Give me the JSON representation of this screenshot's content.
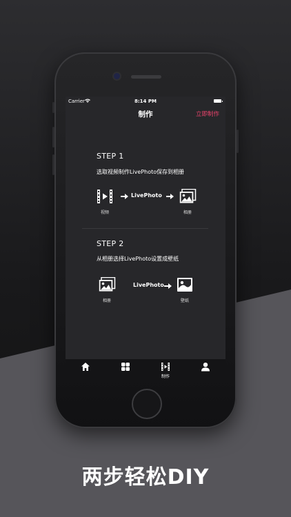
{
  "status_bar": {
    "carrier": "Carrier",
    "time": "8:14 PM"
  },
  "nav": {
    "title": "制作",
    "action": "立即制作"
  },
  "step1": {
    "title": "STEP 1",
    "desc": "选取视频制作LivePhoto保存到相册",
    "from_label": "视频",
    "middle_text": "LivePhoto",
    "to_label": "相册"
  },
  "step2": {
    "title": "STEP 2",
    "desc": "从相册选择LivePhoto设置成壁纸",
    "from_label": "相册",
    "middle_text": "LivePhoto",
    "to_label": "壁纸"
  },
  "tabs": [
    {
      "icon": "home-icon",
      "label": ""
    },
    {
      "icon": "grid-icon",
      "label": ""
    },
    {
      "icon": "video-icon",
      "label": "制作"
    },
    {
      "icon": "person-icon",
      "label": ""
    }
  ],
  "headline": "两步轻松DIY",
  "colors": {
    "accent": "#e7436b",
    "screen_bg": "#27272a"
  }
}
